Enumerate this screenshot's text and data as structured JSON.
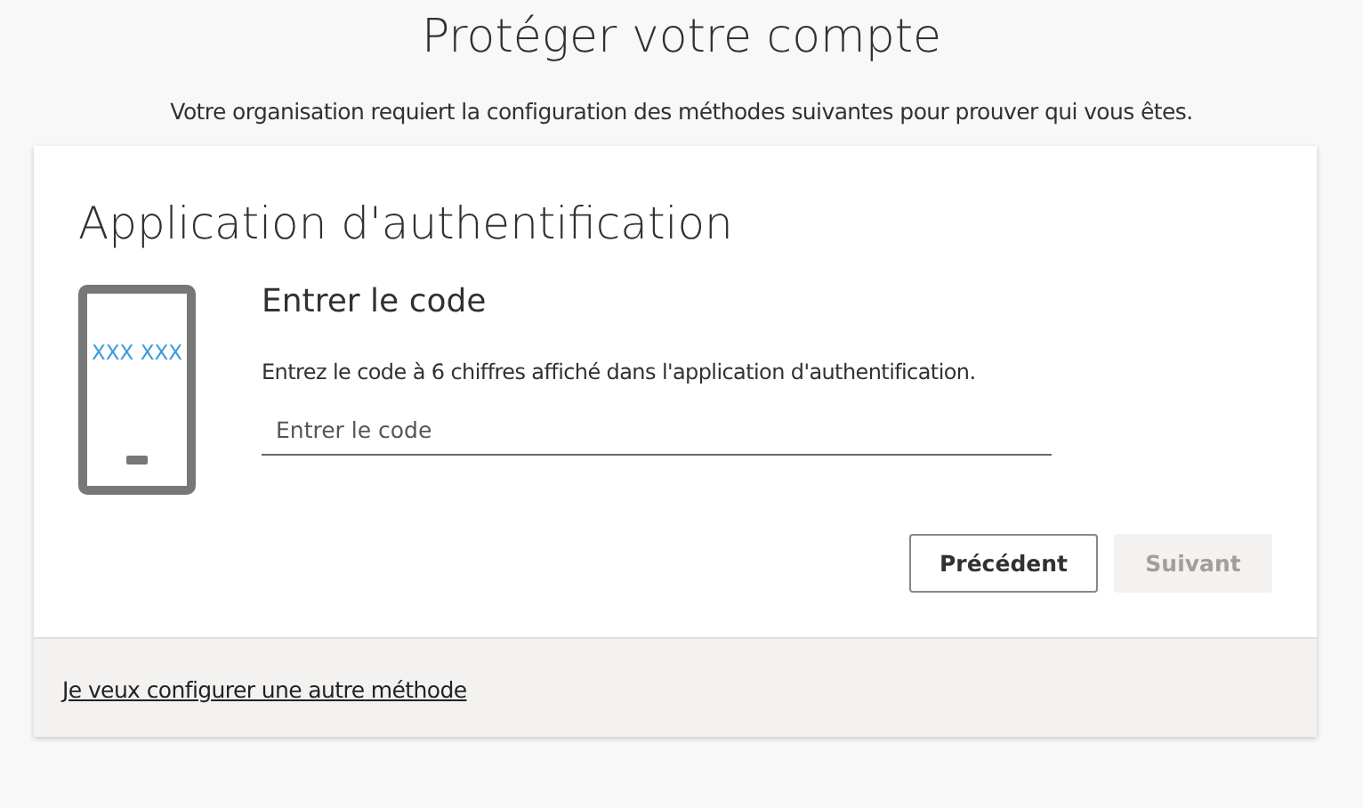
{
  "page": {
    "title": "Protéger votre compte",
    "subtitle": "Votre organisation requiert la configuration des méthodes suivantes pour prouver qui vous êtes."
  },
  "card": {
    "title": "Application d'authentification",
    "phone_code": "XXX XXX",
    "step_title": "Entrer le code",
    "instructions": "Entrez le code à 6 chiffres affiché dans l'application d'authentification.",
    "code_field": {
      "placeholder": "Entrer le code"
    },
    "buttons": [
      {
        "label": "Précédent",
        "disabled": false
      },
      {
        "label": "Suivant",
        "disabled": true
      }
    ],
    "footer_link": "Je veux configurer une autre méthode"
  }
}
